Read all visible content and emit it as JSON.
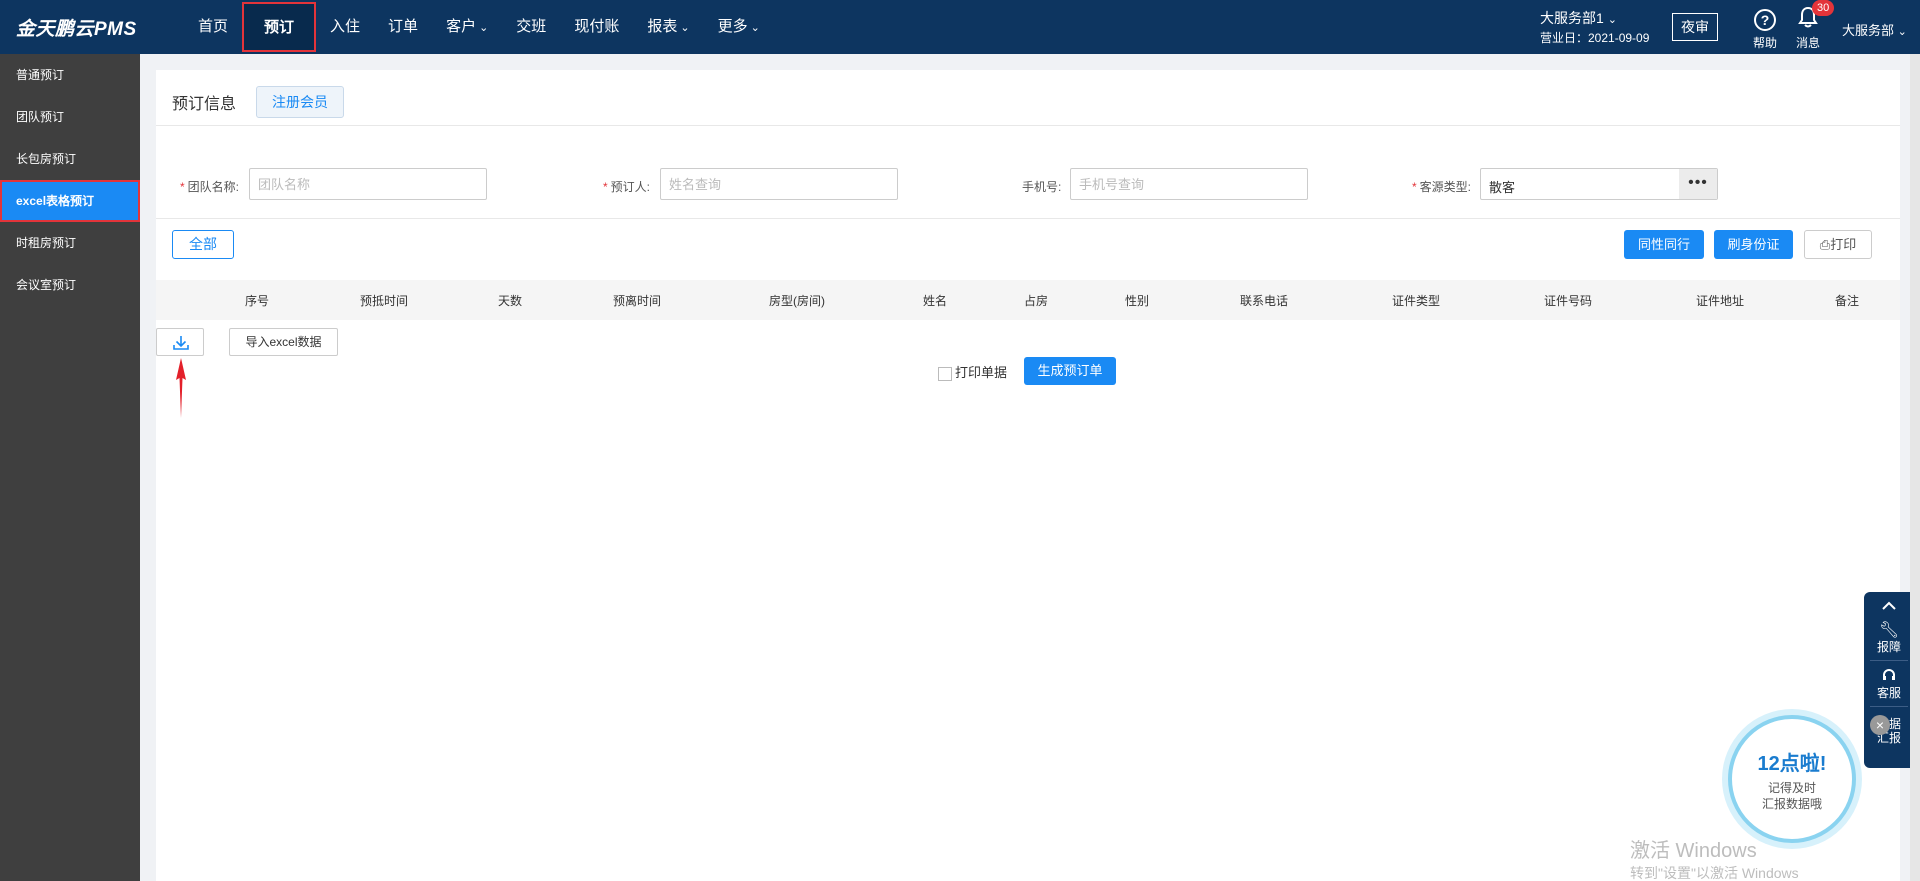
{
  "app": {
    "logo": "金天鹏云PMS"
  },
  "nav": [
    {
      "label": "首页",
      "chev": ""
    },
    {
      "label": "预订",
      "chev": ""
    },
    {
      "label": "入住",
      "chev": ""
    },
    {
      "label": "订单",
      "chev": ""
    },
    {
      "label": "客户",
      "chev": "⌄"
    },
    {
      "label": "交班",
      "chev": ""
    },
    {
      "label": "现付账",
      "chev": ""
    },
    {
      "label": "报表",
      "chev": "⌄"
    },
    {
      "label": "更多",
      "chev": "⌄"
    }
  ],
  "header": {
    "dept": "大服务部1",
    "business_date": "营业日：2021-09-09",
    "night_audit": "夜审",
    "help": "帮助",
    "messages": "消息",
    "message_count": "30",
    "user": "大服务部"
  },
  "sidebar": [
    {
      "label": "普通预订"
    },
    {
      "label": "团队预订"
    },
    {
      "label": "长包房预订"
    },
    {
      "label": "excel表格预订"
    },
    {
      "label": "时租房预订"
    },
    {
      "label": "会议室预订"
    }
  ],
  "panel": {
    "title": "预订信息",
    "register_member": "注册会员"
  },
  "form": {
    "team_name": {
      "label": "团队名称:",
      "placeholder": "团队名称"
    },
    "booker": {
      "label": "预订人:",
      "placeholder": "姓名查询"
    },
    "phone": {
      "label": "手机号:",
      "placeholder": "手机号查询"
    },
    "source_type": {
      "label": "客源类型:",
      "value": "散客",
      "more": "•••"
    }
  },
  "toolbar": {
    "all": "全部",
    "peer": "同性同行",
    "swipe_id": "刷身份证",
    "print": "⎙打印"
  },
  "table": {
    "columns": [
      "序号",
      "预抵时间",
      "天数",
      "预离时间",
      "房型(房间)",
      "姓名",
      "占房",
      "性别",
      "联系电话",
      "证件类型",
      "证件号码",
      "证件地址",
      "备注"
    ]
  },
  "actions": {
    "import_excel": "导入excel数据",
    "print_receipt": "打印单据",
    "generate_order": "生成预订单"
  },
  "float_bar": {
    "report_fault": "报障",
    "service": "客服",
    "data_report_1": "数据",
    "data_report_2": "汇报"
  },
  "reminder": {
    "title": "12点啦!",
    "line1": "记得及时",
    "line2": "汇报数据哦"
  },
  "watermark": {
    "line1": "激活 Windows",
    "line2": "转到\"设置\"以激活 Windows"
  },
  "colors": {
    "topbar": "#0d3560",
    "sidebar": "#3f3f3f",
    "accent": "#1a8af4",
    "highlight_border": "#e3343a"
  }
}
